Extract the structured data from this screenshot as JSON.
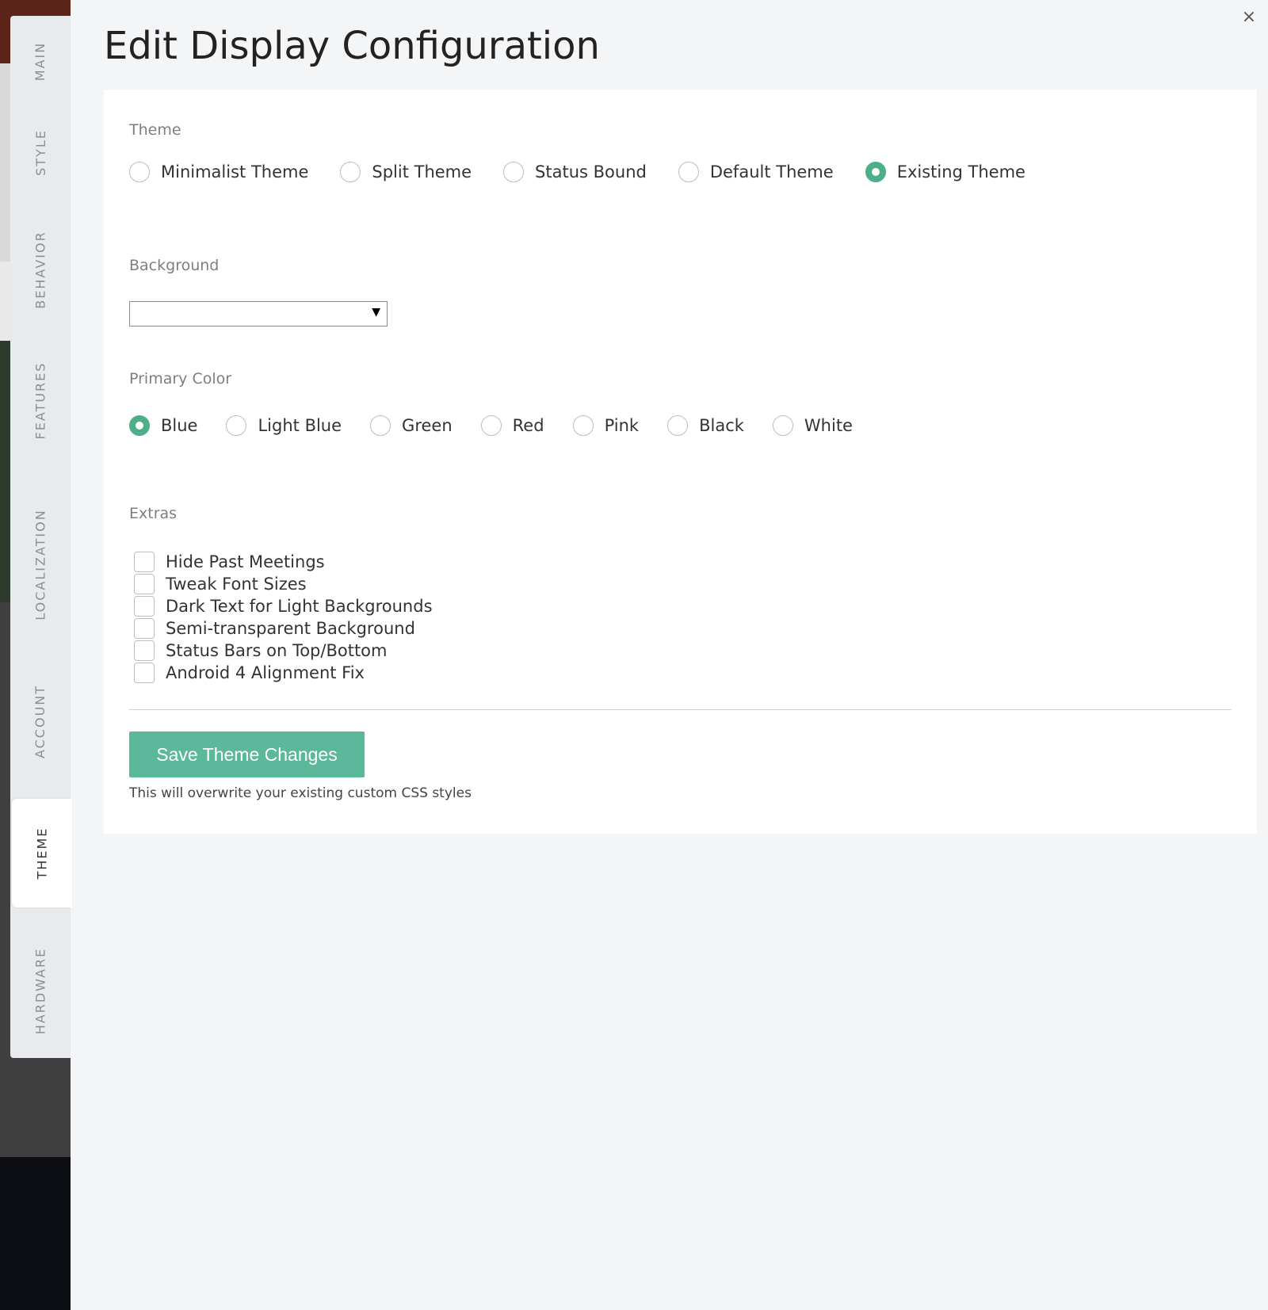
{
  "modal": {
    "title": "Edit Display Configuration",
    "close_label": "×"
  },
  "side_tabs": [
    {
      "label": "MAIN",
      "active": false
    },
    {
      "label": "STYLE",
      "active": false
    },
    {
      "label": "BEHAVIOR",
      "active": false
    },
    {
      "label": "FEATURES",
      "active": false
    },
    {
      "label": "LOCALIZATION",
      "active": false
    },
    {
      "label": "ACCOUNT",
      "active": false
    },
    {
      "label": "THEME",
      "active": true
    },
    {
      "label": "HARDWARE",
      "active": false
    }
  ],
  "theme": {
    "label": "Theme",
    "options": [
      "Minimalist Theme",
      "Split Theme",
      "Status Bound",
      "Default Theme",
      "Existing Theme"
    ],
    "selected": "Existing Theme"
  },
  "background": {
    "label": "Background",
    "selected_value": "",
    "arrow": "▼"
  },
  "primary_color": {
    "label": "Primary Color",
    "options": [
      "Blue",
      "Light Blue",
      "Green",
      "Red",
      "Pink",
      "Black",
      "White"
    ],
    "selected": "Blue"
  },
  "extras": {
    "label": "Extras",
    "items": [
      {
        "label": "Hide Past Meetings",
        "checked": false
      },
      {
        "label": "Tweak Font Sizes",
        "checked": false
      },
      {
        "label": "Dark Text for Light Backgrounds",
        "checked": false
      },
      {
        "label": "Semi-transparent Background",
        "checked": false
      },
      {
        "label": "Status Bars on Top/Bottom",
        "checked": false
      },
      {
        "label": "Android 4 Alignment Fix",
        "checked": false
      }
    ]
  },
  "save_button": "Save Theme Changes",
  "warning": "This will overwrite your existing custom CSS styles",
  "colors": {
    "accent": "#5bb89a",
    "radio_checked": "#4caf89",
    "page_bg": "#f3f5f7",
    "card_bg": "#ffffff"
  }
}
